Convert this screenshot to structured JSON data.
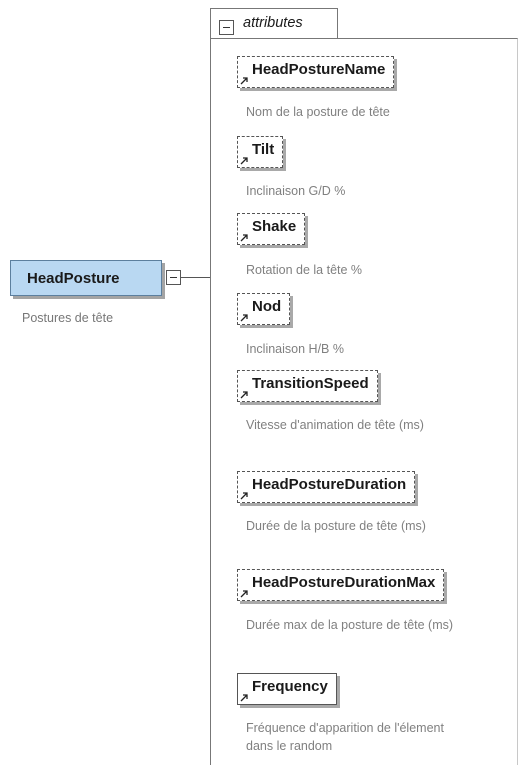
{
  "root": {
    "label": "HeadPosture",
    "description": "Postures de tête"
  },
  "group": {
    "title": "attributes"
  },
  "attributes": [
    {
      "name": "HeadPostureName",
      "description": "Nom de la posture de tête",
      "optional": true
    },
    {
      "name": "Tilt",
      "description": "Inclinaison G/D %",
      "optional": true
    },
    {
      "name": "Shake",
      "description": "Rotation de la tête %",
      "optional": true
    },
    {
      "name": "Nod",
      "description": "Inclinaison H/B %",
      "optional": true
    },
    {
      "name": "TransitionSpeed",
      "description": "Vitesse d'animation de tête (ms)",
      "optional": true
    },
    {
      "name": "HeadPostureDuration",
      "description": "Durée de la posture de tête (ms)",
      "optional": true
    },
    {
      "name": "HeadPostureDurationMax",
      "description": "Durée max de la posture de tête (ms)",
      "optional": true
    },
    {
      "name": "Frequency",
      "description": "Fréquence d'apparition de l'élement dans le random",
      "optional": false
    }
  ]
}
